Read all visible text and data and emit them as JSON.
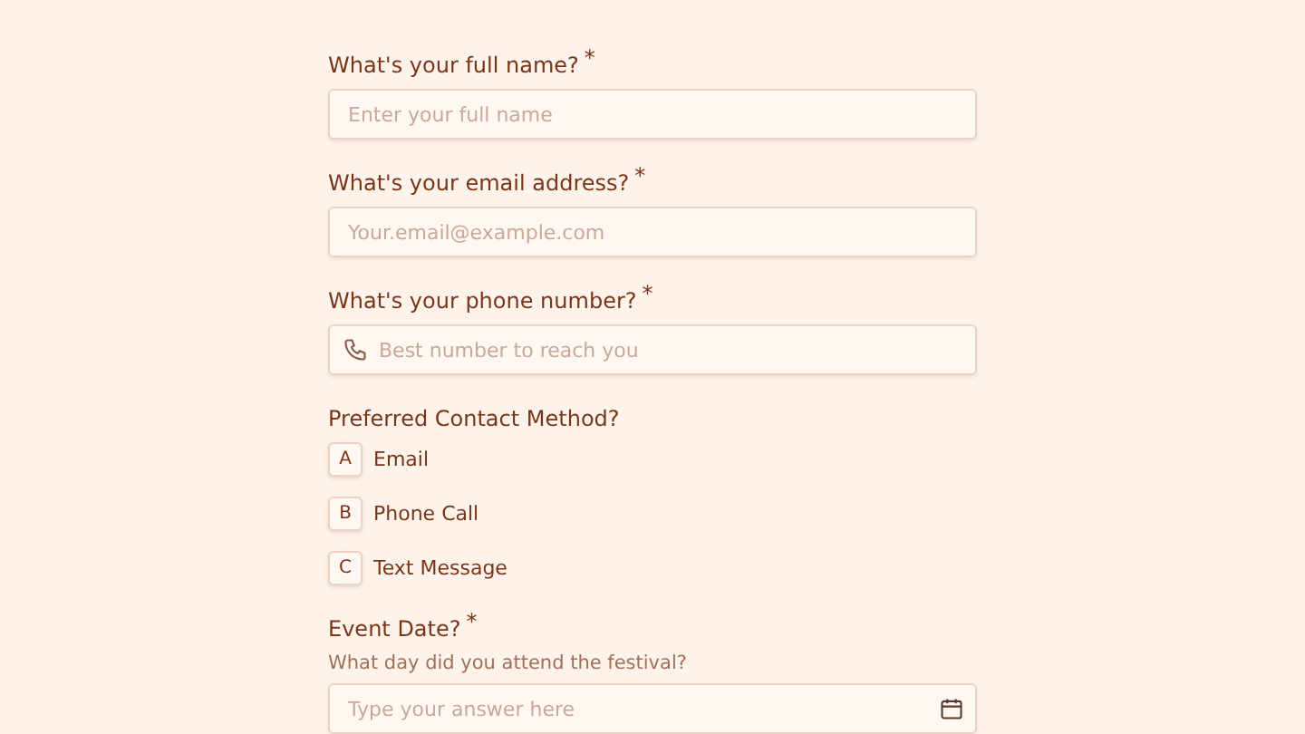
{
  "questions": [
    {
      "kind": "text",
      "label": "What's your full name?",
      "required_mark": "*",
      "placeholder": "Enter your full name"
    },
    {
      "kind": "text",
      "label": "What's your email address?",
      "required_mark": "*",
      "placeholder": "Your.email@example.com"
    },
    {
      "kind": "phone",
      "label": "What's your phone number?",
      "required_mark": "*",
      "placeholder": "Best number to reach you"
    },
    {
      "kind": "choice",
      "label": "Preferred Contact Method?",
      "options": [
        {
          "key": "A",
          "label": "Email",
          "selected": false
        },
        {
          "key": "B",
          "label": "Phone Call",
          "selected": false
        },
        {
          "key": "C",
          "label": "Text Message",
          "selected": false
        }
      ]
    },
    {
      "kind": "date",
      "label": "Event Date?",
      "required_mark": "*",
      "description": "What day did you attend the festival?",
      "placeholder": "Type your answer here"
    }
  ]
}
